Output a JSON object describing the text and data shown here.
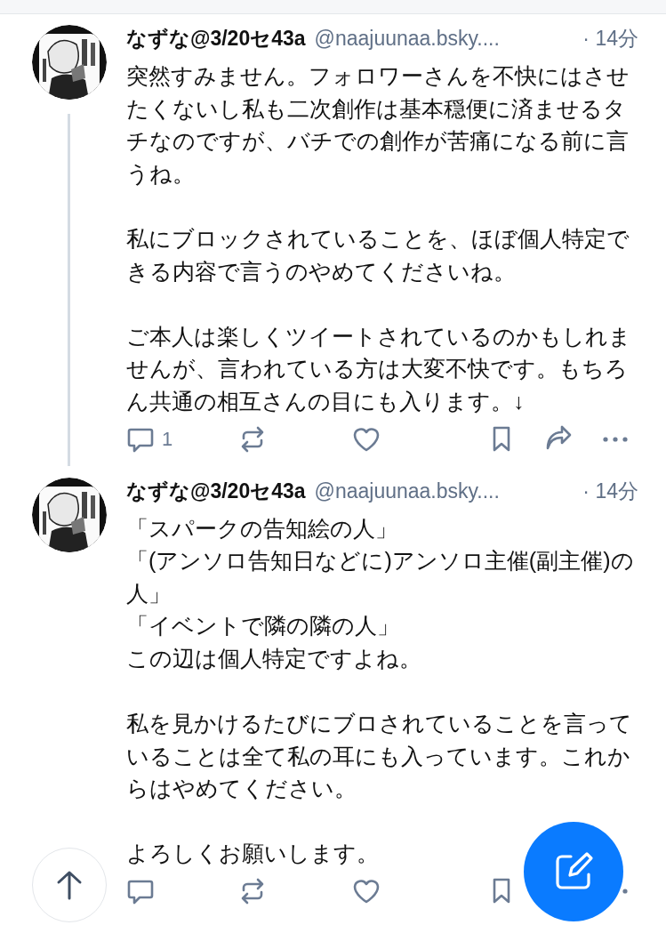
{
  "posts": [
    {
      "author": "なずな@3/20セ43a",
      "handle": "@naajuunaa.bsky....",
      "time": "· 14分",
      "thread_continues": true,
      "paragraphs": [
        "突然すみません。フォロワーさんを不快にはさせたくないし私も二次創作は基本穏便に済ませるタチなのですが、バチでの創作が苦痛になる前に言うね。",
        "私にブロックされていることを、ほぼ個人特定できる内容で言うのやめてくださいね。",
        "ご本人は楽しくツイートされているのかもしれませんが、言われている方は大変不快です。もちろん共通の相互さんの目にも入ります。↓"
      ],
      "actions": [
        {
          "kind": "reply",
          "count": "1"
        },
        {
          "kind": "repost"
        },
        {
          "kind": "like"
        },
        {
          "kind": "bookmark"
        },
        {
          "kind": "share"
        },
        {
          "kind": "more"
        }
      ]
    },
    {
      "author": "なずな@3/20セ43a",
      "handle": "@naajuunaa.bsky....",
      "time": "· 14分",
      "thread_continues": false,
      "paragraphs": [
        [
          "「スパークの告知絵の人」",
          "「(アンソロ告知日などに)アンソロ主催(副主催)の人」",
          "「イベントで隣の隣の人」",
          "この辺は個人特定ですよね。"
        ],
        "私を見かけるたびにブロされていることを言っていることは全て私の耳にも入っています。これからはやめてください。",
        "よろしくお願いします。"
      ],
      "actions": [
        {
          "kind": "reply"
        },
        {
          "kind": "repost"
        },
        {
          "kind": "like"
        },
        {
          "kind": "bookmark"
        },
        {
          "kind": "more",
          "partly_hidden": true
        }
      ]
    }
  ],
  "scroll_top_button": {
    "kind": "up"
  },
  "compose_button": {
    "kind": "compose"
  }
}
